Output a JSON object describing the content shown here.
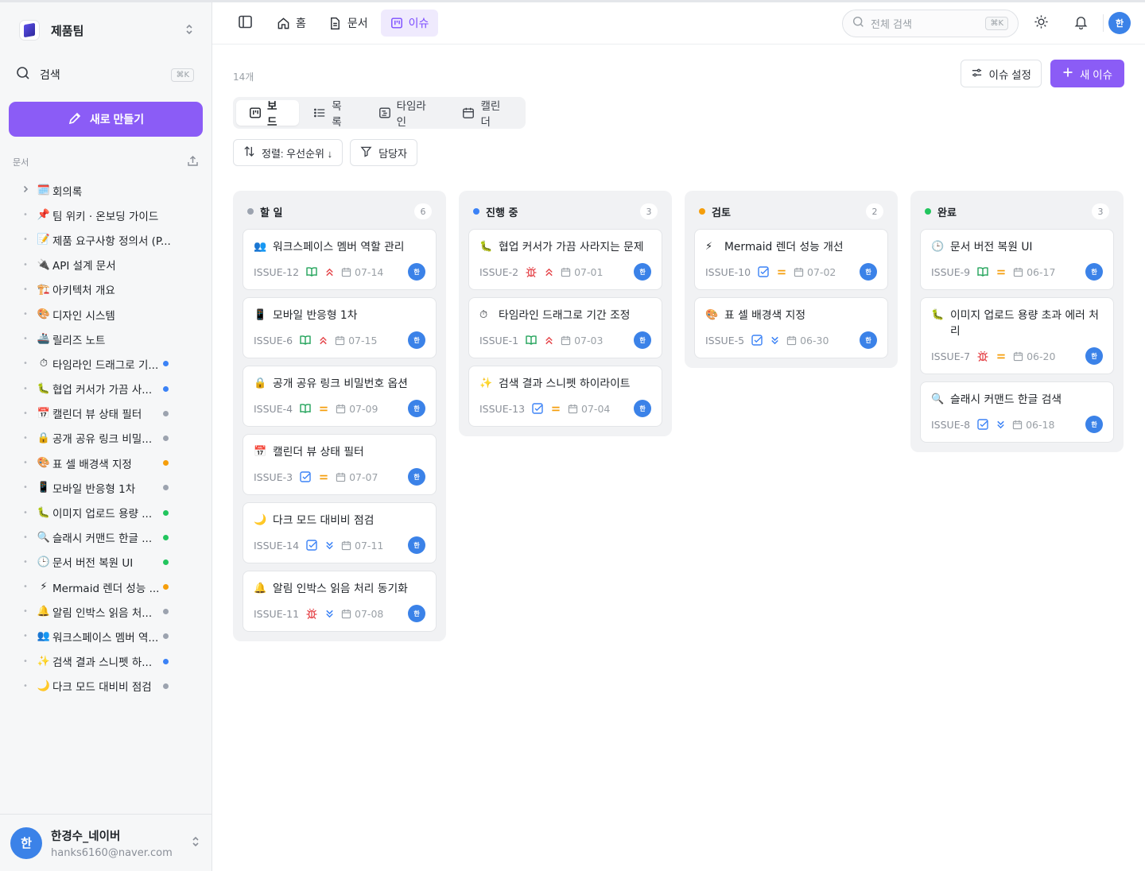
{
  "workspace": {
    "name": "제품팀"
  },
  "sidebar": {
    "search_label": "검색",
    "search_shortcut": "⌘K",
    "new_button": "새로 만들기",
    "section_title": "문서",
    "items": [
      {
        "emoji": "🗓️",
        "title": "회의록",
        "lead": "›",
        "status": ""
      },
      {
        "emoji": "📌",
        "title": "팀 위키 · 온보딩 가이드",
        "lead": "•",
        "status": ""
      },
      {
        "emoji": "📝",
        "title": "제품 요구사항 정의서 (P...",
        "lead": "•",
        "status": ""
      },
      {
        "emoji": "🔌",
        "title": "API 설계 문서",
        "lead": "•",
        "status": ""
      },
      {
        "emoji": "🏗️",
        "title": "아키텍처 개요",
        "lead": "•",
        "status": ""
      },
      {
        "emoji": "🎨",
        "title": "디자인 시스템",
        "lead": "•",
        "status": ""
      },
      {
        "emoji": "🚢",
        "title": "릴리즈 노트",
        "lead": "•",
        "status": ""
      },
      {
        "emoji": "⏱",
        "title": "타임라인 드래그로 기...",
        "lead": "•",
        "status": "#3b82f6"
      },
      {
        "emoji": "🐛",
        "title": "협업 커서가 가끔 사...",
        "lead": "•",
        "status": "#3b82f6"
      },
      {
        "emoji": "📅",
        "title": "캘린더 뷰 상태 필터",
        "lead": "•",
        "status": "#9ca3af"
      },
      {
        "emoji": "🔒",
        "title": "공개 공유 링크 비밀...",
        "lead": "•",
        "status": "#9ca3af"
      },
      {
        "emoji": "🎨",
        "title": "표 셀 배경색 지정",
        "lead": "•",
        "status": "#f59e0b"
      },
      {
        "emoji": "📱",
        "title": "모바일 반응형 1차",
        "lead": "•",
        "status": "#9ca3af"
      },
      {
        "emoji": "🐛",
        "title": "이미지 업로드 용량 ...",
        "lead": "•",
        "status": "#22c55e"
      },
      {
        "emoji": "🔍",
        "title": "슬래시 커맨드 한글 ...",
        "lead": "•",
        "status": "#22c55e"
      },
      {
        "emoji": "🕒",
        "title": "문서 버전 복원 UI",
        "lead": "•",
        "status": "#22c55e"
      },
      {
        "emoji": "⚡",
        "title": "Mermaid 렌더 성능 ...",
        "lead": "•",
        "status": "#f59e0b"
      },
      {
        "emoji": "🔔",
        "title": "알림 인박스 읽음 처...",
        "lead": "•",
        "status": "#9ca3af"
      },
      {
        "emoji": "👥",
        "title": "워크스페이스 멤버 역...",
        "lead": "•",
        "status": "#9ca3af"
      },
      {
        "emoji": "✨",
        "title": "검색 결과 스니펫 하...",
        "lead": "•",
        "status": "#3b82f6"
      },
      {
        "emoji": "🌙",
        "title": "다크 모드 대비비 점검",
        "lead": "•",
        "status": "#9ca3af"
      }
    ]
  },
  "user": {
    "initial": "한",
    "name": "한경수_네이버",
    "email": "hanks6160@naver.com"
  },
  "topbar": {
    "tabs": [
      {
        "icon": "home-icon",
        "label": "홈",
        "active": false
      },
      {
        "icon": "document-icon",
        "label": "문서",
        "active": false
      },
      {
        "icon": "board-icon",
        "label": "이슈",
        "active": true
      }
    ],
    "search_placeholder": "전체 검색",
    "search_shortcut": "⌘K",
    "avatar_initial": "한"
  },
  "issues": {
    "count_label": "14개",
    "settings_button": "이슈 설정",
    "new_issue_button": "새 이슈",
    "views": [
      {
        "icon": "board-icon",
        "label": "보드",
        "active": true
      },
      {
        "icon": "list-icon",
        "label": "목록",
        "active": false
      },
      {
        "icon": "timeline-icon",
        "label": "타임라인",
        "active": false
      },
      {
        "icon": "calendar-icon",
        "label": "캘린더",
        "active": false
      }
    ],
    "sort_button": "정렬: 우선순위 ↓",
    "assignee_button": "담당자",
    "columns": [
      {
        "title": "할 일",
        "count": "6",
        "color": "#9ca3af",
        "cards": [
          {
            "emoji": "👥",
            "title": "워크스페이스 멤버 역할 관리",
            "id": "ISSUE-12",
            "type": "story",
            "priority": "high",
            "date": "07-14"
          },
          {
            "emoji": "📱",
            "title": "모바일 반응형 1차",
            "id": "ISSUE-6",
            "type": "story",
            "priority": "high",
            "date": "07-15"
          },
          {
            "emoji": "🔒",
            "title": "공개 공유 링크 비밀번호 옵션",
            "id": "ISSUE-4",
            "type": "story",
            "priority": "medium",
            "date": "07-09"
          },
          {
            "emoji": "📅",
            "title": "캘린더 뷰 상태 필터",
            "id": "ISSUE-3",
            "type": "task",
            "priority": "medium",
            "date": "07-07"
          },
          {
            "emoji": "🌙",
            "title": "다크 모드 대비비 점검",
            "id": "ISSUE-14",
            "type": "task",
            "priority": "low",
            "date": "07-11"
          },
          {
            "emoji": "🔔",
            "title": "알림 인박스 읽음 처리 동기화",
            "id": "ISSUE-11",
            "type": "bug",
            "priority": "low",
            "date": "07-08"
          }
        ]
      },
      {
        "title": "진행 중",
        "count": "3",
        "color": "#3b82f6",
        "cards": [
          {
            "emoji": "🐛",
            "title": "협업 커서가 가끔 사라지는 문제",
            "id": "ISSUE-2",
            "type": "bug",
            "priority": "high",
            "date": "07-01"
          },
          {
            "emoji": "⏱",
            "title": "타임라인 드래그로 기간 조정",
            "id": "ISSUE-1",
            "type": "story",
            "priority": "high",
            "date": "07-03"
          },
          {
            "emoji": "✨",
            "title": "검색 결과 스니펫 하이라이트",
            "id": "ISSUE-13",
            "type": "task",
            "priority": "medium",
            "date": "07-04"
          }
        ]
      },
      {
        "title": "검토",
        "count": "2",
        "color": "#f59e0b",
        "cards": [
          {
            "emoji": "⚡",
            "title": "Mermaid 렌더 성능 개선",
            "id": "ISSUE-10",
            "type": "task",
            "priority": "medium",
            "date": "07-02"
          },
          {
            "emoji": "🎨",
            "title": "표 셀 배경색 지정",
            "id": "ISSUE-5",
            "type": "task",
            "priority": "low",
            "date": "06-30"
          }
        ]
      },
      {
        "title": "완료",
        "count": "3",
        "color": "#22c55e",
        "cards": [
          {
            "emoji": "🕒",
            "title": "문서 버전 복원 UI",
            "id": "ISSUE-9",
            "type": "story",
            "priority": "medium",
            "date": "06-17"
          },
          {
            "emoji": "🐛",
            "title": "이미지 업로드 용량 초과 에러 처리",
            "id": "ISSUE-7",
            "type": "bug",
            "priority": "medium",
            "date": "06-20"
          },
          {
            "emoji": "🔍",
            "title": "슬래시 커맨드 한글 검색",
            "id": "ISSUE-8",
            "type": "task",
            "priority": "low",
            "date": "06-18"
          }
        ]
      }
    ]
  },
  "colors": {
    "accent": "#8b5cf6",
    "story": "#22a35a",
    "task": "#3b82f6",
    "bug": "#e5484d",
    "priority_high": "#e5484d",
    "priority_medium": "#f59e0b",
    "priority_low": "#3b82f6",
    "avatar": "#3b82e8"
  }
}
